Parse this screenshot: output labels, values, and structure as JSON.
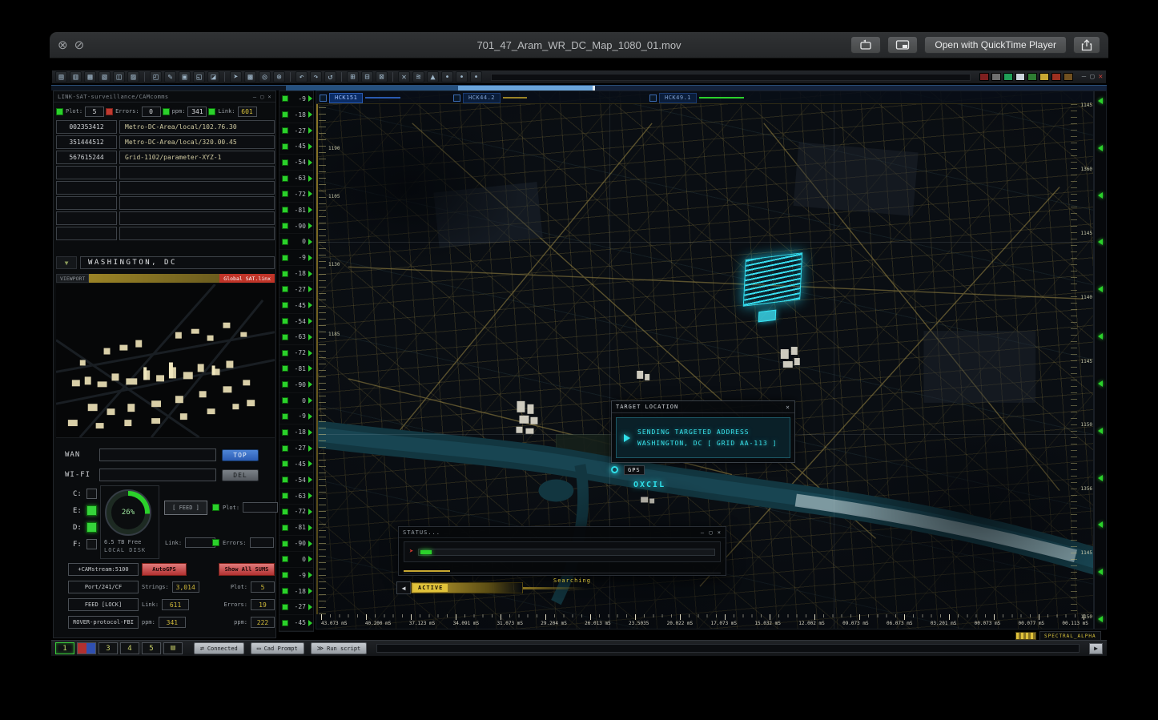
{
  "qt": {
    "title": "701_47_Aram_WR_DC_Map_1080_01.mov",
    "open_with": "Open with QuickTime Player",
    "close_glyph": "⊗",
    "slash_glyph": "⊘"
  },
  "toolbar": {
    "icons": [
      {
        "name": "new-doc-icon",
        "glyph": "▤"
      },
      {
        "name": "open-file-icon",
        "glyph": "▥"
      },
      {
        "name": "copy-doc-icon",
        "glyph": "▦"
      },
      {
        "name": "stack-docs-icon",
        "glyph": "▧"
      },
      {
        "name": "import-doc-icon",
        "glyph": "◫"
      },
      {
        "name": "export-doc-icon",
        "glyph": "▨"
      },
      {
        "sep": true
      },
      {
        "name": "folder-icon",
        "glyph": "◰"
      },
      {
        "name": "edit-pen-icon",
        "glyph": "✎"
      },
      {
        "name": "save-disk-icon",
        "glyph": "▣"
      },
      {
        "name": "clipboard-icon",
        "glyph": "◱"
      },
      {
        "name": "attach-icon",
        "glyph": "◪"
      },
      {
        "sep": true
      },
      {
        "name": "pin-icon",
        "glyph": "➤"
      },
      {
        "name": "layers-icon",
        "glyph": "▩"
      },
      {
        "name": "target-icon",
        "glyph": "◎"
      },
      {
        "name": "abort-icon",
        "glyph": "⊗"
      },
      {
        "sep": true
      },
      {
        "name": "undo-icon",
        "glyph": "↶"
      },
      {
        "name": "redo-icon",
        "glyph": "↷"
      },
      {
        "name": "refresh-icon",
        "glyph": "↺"
      },
      {
        "sep": true
      },
      {
        "name": "grid-view-icon",
        "glyph": "⊞"
      },
      {
        "name": "table-view-icon",
        "glyph": "⊟"
      },
      {
        "name": "chart-view-icon",
        "glyph": "⊠"
      },
      {
        "sep": true
      },
      {
        "name": "close-x-icon",
        "glyph": "✕"
      },
      {
        "name": "wave-icon",
        "glyph": "≋"
      },
      {
        "name": "marker-icon",
        "glyph": "▲"
      },
      {
        "name": "dot-icon",
        "glyph": "•"
      },
      {
        "name": "dot-icon",
        "glyph": "•"
      },
      {
        "name": "dot-icon",
        "glyph": "•"
      }
    ],
    "indicators": [
      {
        "name": "indicator-red",
        "color": "#7e1f1f"
      },
      {
        "name": "indicator-gray",
        "color": "#6e6e6e"
      },
      {
        "name": "indicator-green",
        "color": "#1f9e56"
      },
      {
        "name": "indicator-white",
        "color": "#ccd4dc"
      },
      {
        "name": "indicator-darkgreen",
        "color": "#2e7d32"
      },
      {
        "name": "indicator-yellow",
        "color": "#c8a832"
      },
      {
        "name": "indicator-darkred",
        "color": "#9e3020"
      },
      {
        "name": "indicator-amber",
        "color": "#705020"
      }
    ],
    "controls": {
      "min": "—",
      "max": "▢",
      "close": "✕"
    }
  },
  "panel": {
    "header": "LINK-SAT-surveillance/CAMcomms",
    "controls": "— ▢ ×",
    "stats": {
      "plot_l": "Plot:",
      "plot_v": "5",
      "err_l": "Errors:",
      "err_v": "0",
      "ppm_l": "ppm:",
      "ppm_v": "341",
      "link_l": "Link:",
      "link_v": "601"
    },
    "table": [
      {
        "id": "002353412",
        "value": "Metro-DC-Area/local/102.76.30"
      },
      {
        "id": "351444512",
        "value": "Metro-DC-Area/local/320.00.45"
      },
      {
        "id": "567615244",
        "value": "Grid-1102/parameter-XYZ-1"
      },
      {
        "id": "",
        "value": ""
      },
      {
        "id": "",
        "value": ""
      },
      {
        "id": "",
        "value": ""
      },
      {
        "id": "",
        "value": ""
      },
      {
        "id": "",
        "value": ""
      }
    ],
    "city": "WASHINGTON, DC",
    "tri": "▼",
    "viewport": "VIEWPORT",
    "sat": "Global SAT.linx",
    "wan_label": "WAN",
    "wifi_label": "WI-FI",
    "top_btn": "TOP",
    "del_btn": "DEL",
    "drives": [
      {
        "label": "C:"
      },
      {
        "label": "E:",
        "state": "on"
      },
      {
        "label": "D:",
        "state": "on"
      },
      {
        "label": "F:"
      }
    ],
    "gauge_pct": "26%",
    "feed_btn": "[ FEED ]",
    "plot_label": "Plot:",
    "disk_free": "6.5 TB Free",
    "disk_label": "LOCAL DISK",
    "link_label": "Link:",
    "errors_label": "Errors:",
    "grid": {
      "r1": [
        "+CAMstream:5100",
        "AutoGPS",
        "Show All SUMS"
      ],
      "r2": {
        "c1": "Port/241/CF",
        "l1": "Strings:",
        "v1": "3,014",
        "l2": "Plot:",
        "v2": "5"
      },
      "r3": {
        "c1": "FEED [LOCK]",
        "l1": "Link:",
        "v1": "611",
        "l2": "Errors:",
        "v2": "19"
      },
      "r4": {
        "c1": "ROVER-protocol-FBI",
        "l1": "ppm:",
        "v1": "341",
        "l2": "ppm:",
        "v2": "222"
      }
    }
  },
  "levels": [
    -9,
    -18,
    -27,
    -45,
    -54,
    -63,
    -72,
    -81,
    -90,
    0,
    -9,
    -18,
    -27,
    -45,
    -54,
    -63,
    -72,
    -81,
    -90,
    0,
    -9,
    -18,
    -27,
    -45,
    -54,
    -63,
    -72,
    -81,
    -90,
    0,
    -9,
    -18,
    -27,
    -45
  ],
  "map": {
    "tabs": [
      {
        "label": "HCK151"
      },
      {
        "label": "HCK44.2"
      },
      {
        "label": "HCK49.1"
      }
    ],
    "left_ruler": [
      "1190",
      "1105",
      "1130",
      "1185"
    ],
    "right_ruler": [
      "1145",
      "1360",
      "1145",
      "1140",
      "1145",
      "1150",
      "1356",
      "1145",
      "1150"
    ],
    "target": {
      "title": "TARGET LOCATION",
      "close": "×",
      "line1": "SENDING TARGETED ADDRESS",
      "line2": "WASHINGTON, DC [ GRID AA-113 ]"
    },
    "gps": "GPS",
    "glitch": "OXCIL",
    "status_title": "STATUS...",
    "status_controls": "— ▢ ×",
    "active": "ACTIVE",
    "searching": "Searching",
    "speaker_glyph": "◀",
    "red_arrow": "➤",
    "ruler": [
      "43.073 mS",
      "40.200 mS",
      "37.123 mS",
      "34.091 mS",
      "31.073 mS",
      "29.204 mS",
      "26.013 mS",
      "23.5035",
      "20.022 mS",
      "17.073 mS",
      "15.032 mS",
      "12.002 mS",
      "09.073 mS",
      "06.073 mS",
      "03.201 mS",
      "00.073 mS",
      "00.077 mS",
      "00.113 mS"
    ]
  },
  "right_markers": [
    "",
    "",
    "",
    "",
    "",
    "",
    "",
    "",
    "",
    "",
    "",
    ""
  ],
  "bottombar": {
    "pages": [
      {
        "label": "1",
        "state": "active"
      },
      {
        "label": "",
        "state": "split"
      },
      {
        "label": "3"
      },
      {
        "label": "4"
      },
      {
        "label": "5"
      },
      {
        "label": "",
        "state": "folder",
        "glyph": "▤"
      }
    ],
    "tabs": [
      {
        "label": "Connected",
        "icon": "⇄"
      },
      {
        "label": "Cad Prompt",
        "icon": "▭"
      },
      {
        "label": "Run script",
        "icon": "≫"
      }
    ],
    "spectral": "SPECTRAL_ALPHA",
    "next": "▶"
  }
}
